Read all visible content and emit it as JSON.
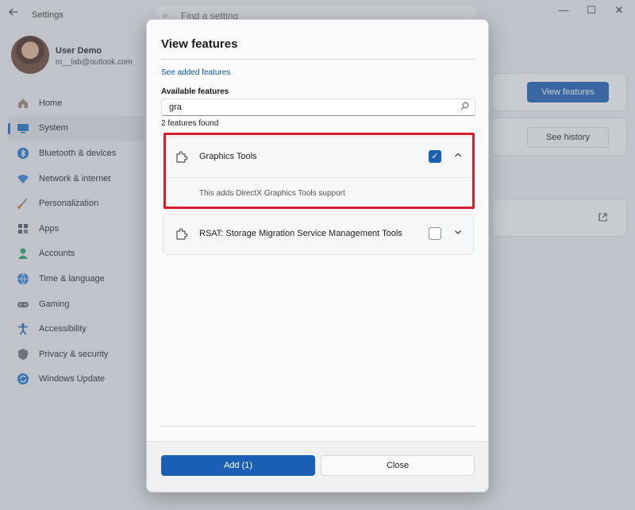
{
  "window": {
    "app_title": "Settings",
    "search_placeholder": "Find a setting",
    "minimize_glyph": "—",
    "maximize_glyph": "☐",
    "close_glyph": "✕"
  },
  "profile": {
    "name": "User Demo",
    "email": "m__lab@outlook.com"
  },
  "sidebar": {
    "items": [
      {
        "label": "Home",
        "icon": "home-icon",
        "color": "#7c6a58"
      },
      {
        "label": "System",
        "icon": "display-icon",
        "color": "#1f6fc0",
        "active": true
      },
      {
        "label": "Bluetooth & devices",
        "icon": "bluetooth-icon",
        "color": "#1f73d0"
      },
      {
        "label": "Network & internet",
        "icon": "wifi-icon",
        "color": "#2f7fd3"
      },
      {
        "label": "Personalization",
        "icon": "brush-icon",
        "color": "#c47a2c"
      },
      {
        "label": "Apps",
        "icon": "apps-icon",
        "color": "#4d5663"
      },
      {
        "label": "Accounts",
        "icon": "person-icon",
        "color": "#27a069"
      },
      {
        "label": "Time & language",
        "icon": "globe-clock-icon",
        "color": "#2b7cd3"
      },
      {
        "label": "Gaming",
        "icon": "gamepad-icon",
        "color": "#6b7179"
      },
      {
        "label": "Accessibility",
        "icon": "accessibility-icon",
        "color": "#1d63b8"
      },
      {
        "label": "Privacy & security",
        "icon": "shield-icon",
        "color": "#6b7179"
      },
      {
        "label": "Windows Update",
        "icon": "sync-icon",
        "color": "#1f73d0"
      }
    ]
  },
  "background": {
    "view_features_label": "View features",
    "see_history_label": "See history",
    "open_icon": "open-external-icon"
  },
  "dialog": {
    "title": "View features",
    "see_added_link": "See added features",
    "available_label": "Available features",
    "search_value": "gra",
    "found_text": "2 features found",
    "features": [
      {
        "name": "Graphics Tools",
        "checked": true,
        "expanded": true,
        "description": "This adds DirectX Graphics Tools support"
      },
      {
        "name": "RSAT: Storage Migration Service Management Tools",
        "checked": false,
        "expanded": false
      }
    ],
    "add_label": "Add (1)",
    "close_label": "Close"
  },
  "colors": {
    "accent": "#1a5fb4",
    "highlight": "#d21f2b"
  }
}
